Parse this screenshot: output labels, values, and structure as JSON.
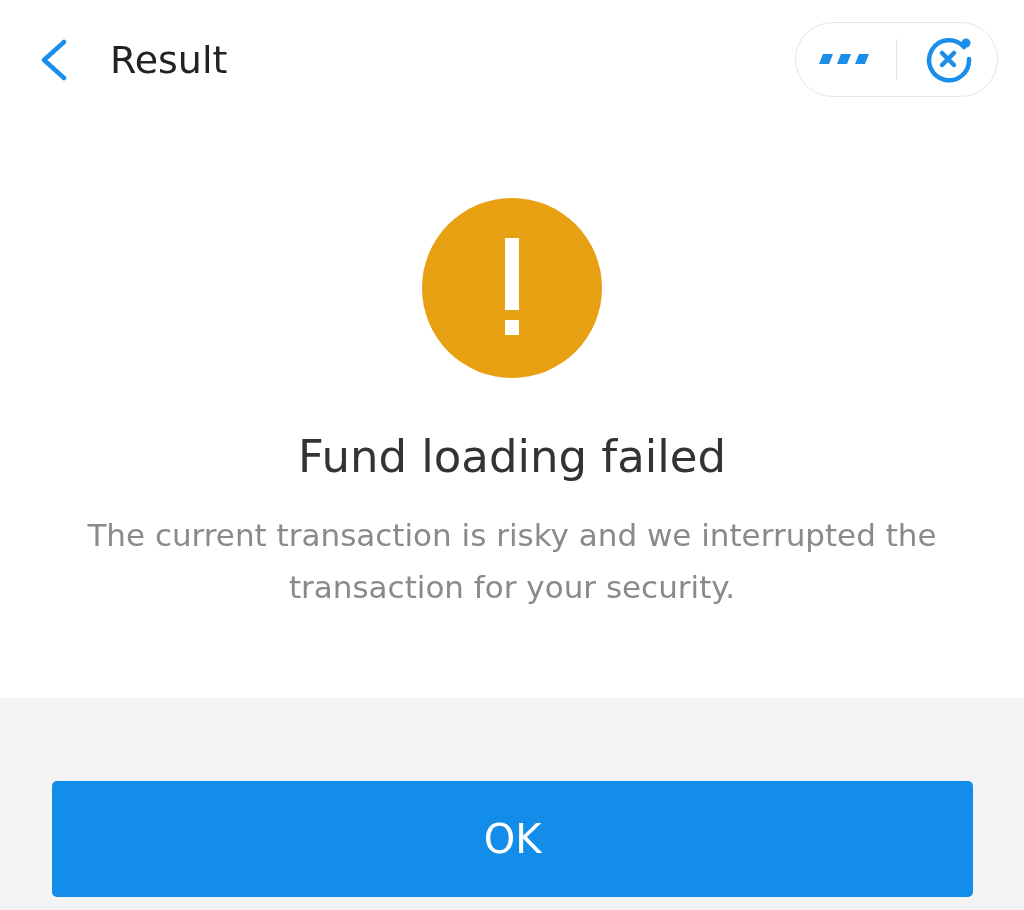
{
  "header": {
    "title": "Result"
  },
  "result": {
    "kind": "warning",
    "title": "Fund loading failed",
    "message": "The current transaction is risky and we interrupted the transaction for your security."
  },
  "buttons": [
    {
      "label": "OK"
    }
  ]
}
